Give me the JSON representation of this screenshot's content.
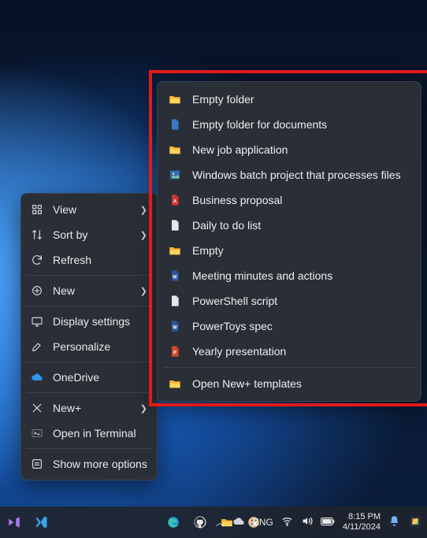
{
  "context_menu": {
    "items": [
      {
        "label": "View",
        "icon": "grid-icon",
        "sub": true
      },
      {
        "label": "Sort by",
        "icon": "sort-icon",
        "sub": true
      },
      {
        "label": "Refresh",
        "icon": "refresh-icon"
      },
      {
        "label": "New",
        "icon": "plus-icon",
        "sub": true
      },
      {
        "label": "Display settings",
        "icon": "display-icon"
      },
      {
        "label": "Personalize",
        "icon": "brush-icon"
      },
      {
        "label": "OneDrive",
        "icon": "cloud-icon"
      },
      {
        "label": "New+",
        "icon": "newplus-icon",
        "sub": true
      },
      {
        "label": "Open in Terminal",
        "icon": "terminal-icon"
      },
      {
        "label": "Show more options",
        "icon": "more-icon"
      }
    ],
    "separators_after": [
      2,
      3,
      5,
      6,
      8
    ]
  },
  "newplus_submenu": {
    "items": [
      {
        "label": "Empty folder",
        "icon": "folder"
      },
      {
        "label": "Empty folder for documents",
        "icon": "doc-blue"
      },
      {
        "label": "New job application",
        "icon": "folder"
      },
      {
        "label": "Windows batch project that processes files",
        "icon": "picture"
      },
      {
        "label": "Business proposal",
        "icon": "pdf"
      },
      {
        "label": "Daily to do list",
        "icon": "text"
      },
      {
        "label": "Empty",
        "icon": "folder"
      },
      {
        "label": "Meeting minutes and actions",
        "icon": "word"
      },
      {
        "label": "PowerShell script",
        "icon": "text"
      },
      {
        "label": "PowerToys spec",
        "icon": "word"
      },
      {
        "label": "Yearly presentation",
        "icon": "ppt"
      }
    ],
    "footer": {
      "label": "Open New+ templates",
      "icon": "folder"
    }
  },
  "taskbar": {
    "left_apps": [
      "vs-icon",
      "vscode-icon"
    ],
    "center_apps": [
      "edge-icon",
      "github-icon",
      "explorer-icon",
      "paint-icon"
    ],
    "tray": {
      "lang": "ENG"
    },
    "clock": {
      "time": "8:15 PM",
      "date": "4/11/2024"
    }
  }
}
